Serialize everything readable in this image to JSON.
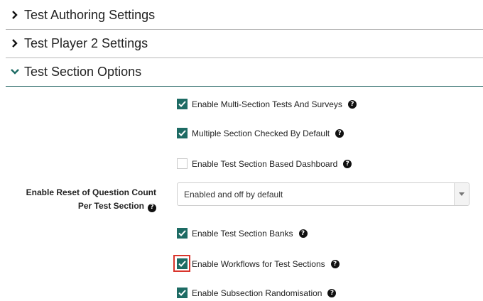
{
  "sections": [
    {
      "title": "Test Authoring Settings",
      "expanded": false
    },
    {
      "title": "Test Player 2 Settings",
      "expanded": false
    },
    {
      "title": "Test Section Options",
      "expanded": true
    }
  ],
  "options": {
    "multi_section": {
      "label": "Enable Multi-Section Tests And Surveys",
      "checked": true
    },
    "multi_default": {
      "label": "Multiple Section Checked By Default",
      "checked": true
    },
    "dashboard": {
      "label": "Enable Test Section Based Dashboard",
      "checked": false
    },
    "banks": {
      "label": "Enable Test Section Banks",
      "checked": true
    },
    "workflows": {
      "label": "Enable Workflows for Test Sections",
      "checked": true
    },
    "randomisation": {
      "label": "Enable Subsection Randomisation",
      "checked": true
    }
  },
  "reset_count": {
    "label_line1": "Enable Reset of Question Count",
    "label_line2": "Per Test Section",
    "selected": "Enabled and off by default"
  },
  "help_glyph": "?",
  "colors": {
    "accent": "#1d6b64",
    "highlight": "#d9352d",
    "divider_active": "#1d5f5e"
  }
}
